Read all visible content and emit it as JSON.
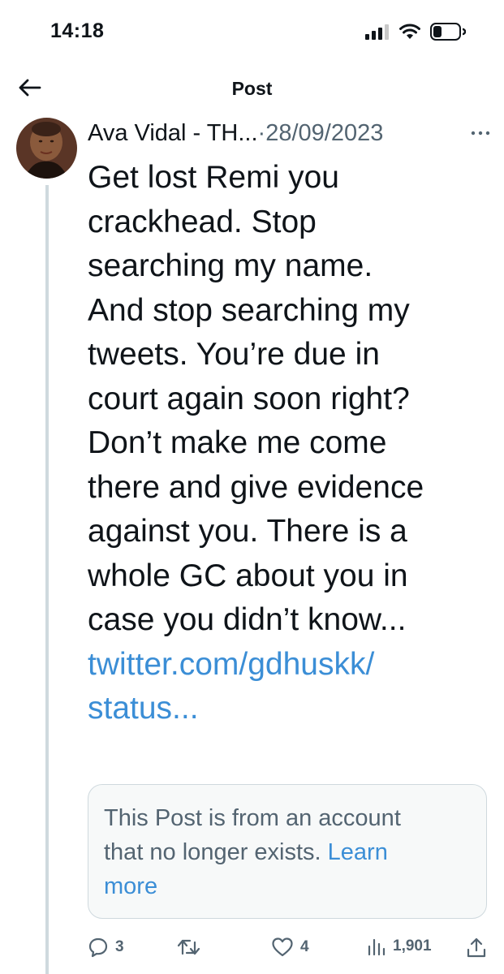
{
  "status_bar": {
    "time": "14:18",
    "icons": [
      "cellular-signal-icon",
      "wifi-icon",
      "battery-icon"
    ]
  },
  "header": {
    "title": "Post",
    "back_icon": "arrow-left-icon"
  },
  "post": {
    "author_name": "Ava Vidal - TH...",
    "separator": "·",
    "date": "28/09/2023",
    "more_icon": "more-horizontal-icon",
    "text_lines": [
      "Get lost Remi you",
      "crackhead. Stop",
      "searching my name.",
      "And stop searching my",
      "tweets. You’re due in",
      "court again soon right?",
      "Don’t make me come",
      "there and give evidence",
      "against you. There is a",
      "whole GC about you in",
      "case you didn’t know..."
    ],
    "link_lines": [
      "twitter.com/gdhuskk/",
      "status..."
    ],
    "notice": {
      "line1": "This Post is from an account",
      "line2_text": "that no longer exists.",
      "line2_link": "Learn",
      "line3_link": "more"
    },
    "actions": {
      "replies": "3",
      "reposts": "",
      "likes": "4",
      "views": "1,901"
    }
  },
  "colors": {
    "text": "#0f1419",
    "secondary": "#536471",
    "link": "#3b8ed6",
    "border": "#cfd9de"
  }
}
